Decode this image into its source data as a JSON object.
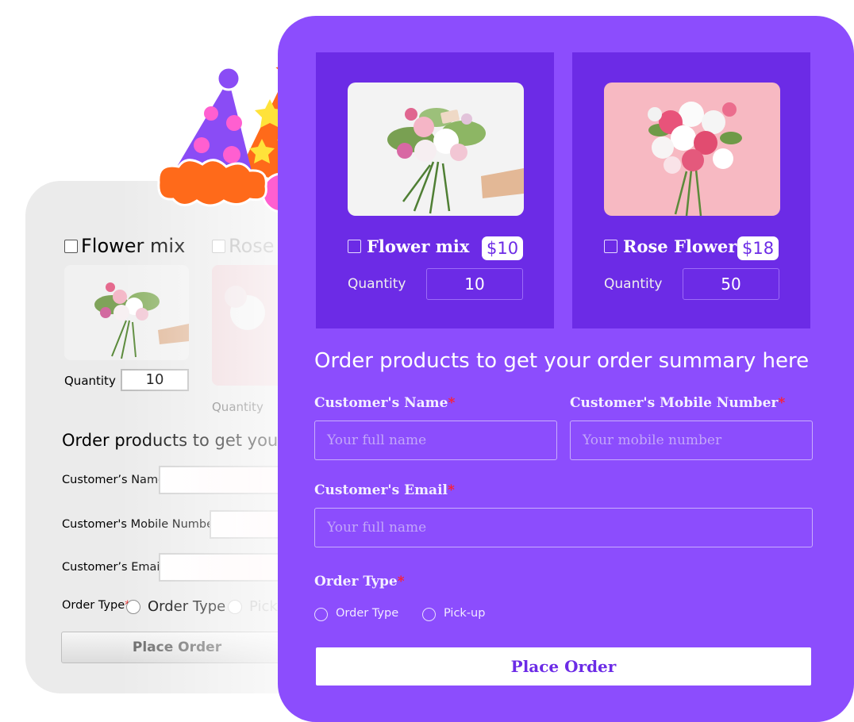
{
  "old_form": {
    "products": [
      {
        "name": "Flower mix",
        "quantity_label": "Quantity",
        "quantity": "10"
      },
      {
        "name": "Rose",
        "quantity_label": "Quantity"
      }
    ],
    "summary_heading": "Order products to get your order",
    "fields": [
      {
        "label": "Customer’s Name"
      },
      {
        "label": "Customer's Mobile Number"
      },
      {
        "label": "Customer’s Email"
      }
    ],
    "required_mark": "*",
    "order_type_label": "Order Type",
    "radio_options": [
      "Order Type",
      "Pick-"
    ],
    "submit_label": "Place Order"
  },
  "new_form": {
    "products": [
      {
        "name": "Flower mix",
        "price": "$10",
        "quantity_label": "Quantity",
        "quantity": "10"
      },
      {
        "name": "Rose Flower",
        "price": "$18",
        "quantity_label": "Quantity",
        "quantity": "50"
      }
    ],
    "summary_heading": "Order products to get your order summary here",
    "fields": {
      "name": {
        "label": "Customer's Name",
        "placeholder": "Your full name"
      },
      "mobile": {
        "label": "Customer's Mobile Number",
        "placeholder": "Your mobile number"
      },
      "email": {
        "label": "Customer's Email",
        "placeholder": "Your full name"
      }
    },
    "required_mark": "*",
    "order_type": {
      "label": "Order Type",
      "options": [
        "Order Type",
        "Pick-up"
      ]
    },
    "submit_label": "Place Order"
  },
  "colors": {
    "panel_purple": "#8c4dfd",
    "card_purple": "#6c2be6",
    "required_red": "#ff1f2d",
    "hat_orange": "#ff6a1a",
    "hat_purple": "#8a4cf5",
    "hat_pink": "#ff5fd0"
  },
  "icons": [
    "party-hat-icon",
    "star-icon",
    "checkbox-icon",
    "radio-icon"
  ]
}
